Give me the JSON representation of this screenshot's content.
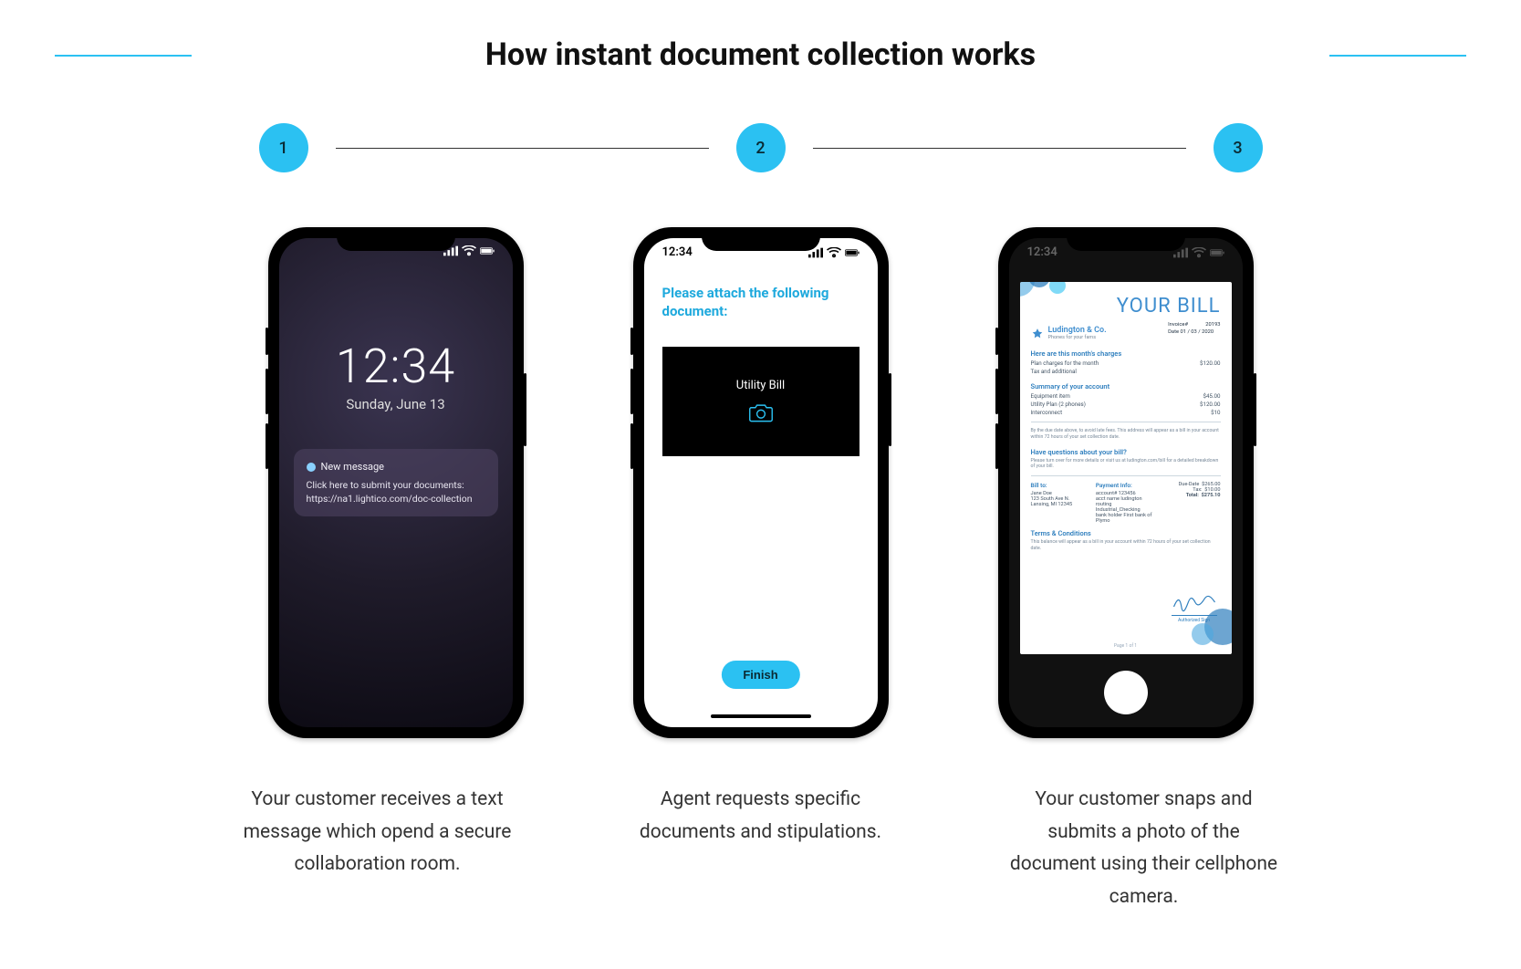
{
  "title": "How instant document collection works",
  "steps": {
    "numbers": [
      "1",
      "2",
      "3"
    ],
    "captions": [
      "Your customer receives a text message which opend a secure collaboration room.",
      "Agent requests specific documents and stipulations.",
      "Your customer snaps and submits a photo of the document using their cellphone camera."
    ]
  },
  "phone_status_time": "12:34",
  "phone1": {
    "time": "12:34",
    "date": "Sunday, June 13",
    "notification_title": "New message",
    "notification_line1": "Click here to submit your documents:",
    "notification_line2": "https://na1.lightico.com/doc-collection"
  },
  "phone2": {
    "heading": "Please attach the following document:",
    "doc_label": "Utility Bill",
    "finish_label": "Finish"
  },
  "phone3": {
    "bill_title": "YOUR BILL",
    "company": "Ludington & Co.",
    "tagline": "Phones for your fams",
    "meta_invoice_label": "Invoice#",
    "meta_invoice_value": "20193",
    "meta_date_label": "Date",
    "meta_date_value": "01 / 03 / 2020",
    "section_charges": "Here are this month's charges",
    "charges": [
      {
        "label": "Plan charges for the month",
        "value": "$120.00"
      },
      {
        "label": "Tax and additional",
        "value": ""
      }
    ],
    "section_summary": "Summary of your account",
    "summary": [
      {
        "label": "Equipment item",
        "value": "$45.00"
      },
      {
        "label": "Utility Plan (2 phones)",
        "value": "$120.00"
      },
      {
        "label": "Interconnect",
        "value": "$10"
      }
    ],
    "fine_print": "By the due date above, to avoid late fees. This address will appear as a bill in your account within 72 hours of your set collection date.",
    "section_questions": "Have questions about your bill?",
    "questions_text": "Please turn over for more details or visit us at ludington.com/bill for a detailed breakdown of your bill.",
    "billto_h": "Bill to:",
    "billto_lines": [
      "Jane Doe",
      "123 South Ave N.",
      "Lansing, MI 12345"
    ],
    "payment_h": "Payment Info:",
    "payment_lines": [
      "account#   123456",
      "acct name  ludington",
      "routing    Industrial_Checking",
      "bank holder  First bank of Plymo"
    ],
    "due_label": "Due-Date",
    "due_value": "$265.00",
    "tax_label": "Tax:",
    "tax_value": "$10.00",
    "total_label": "Total:",
    "total_value": "$275.10",
    "terms_h": "Terms & Conditions",
    "terms_text": "This balance will appear as a bill in your account within 72 hours of your set collection date.",
    "signature_label": "Authorized Sign",
    "page_number": "Page 1 of 1"
  }
}
